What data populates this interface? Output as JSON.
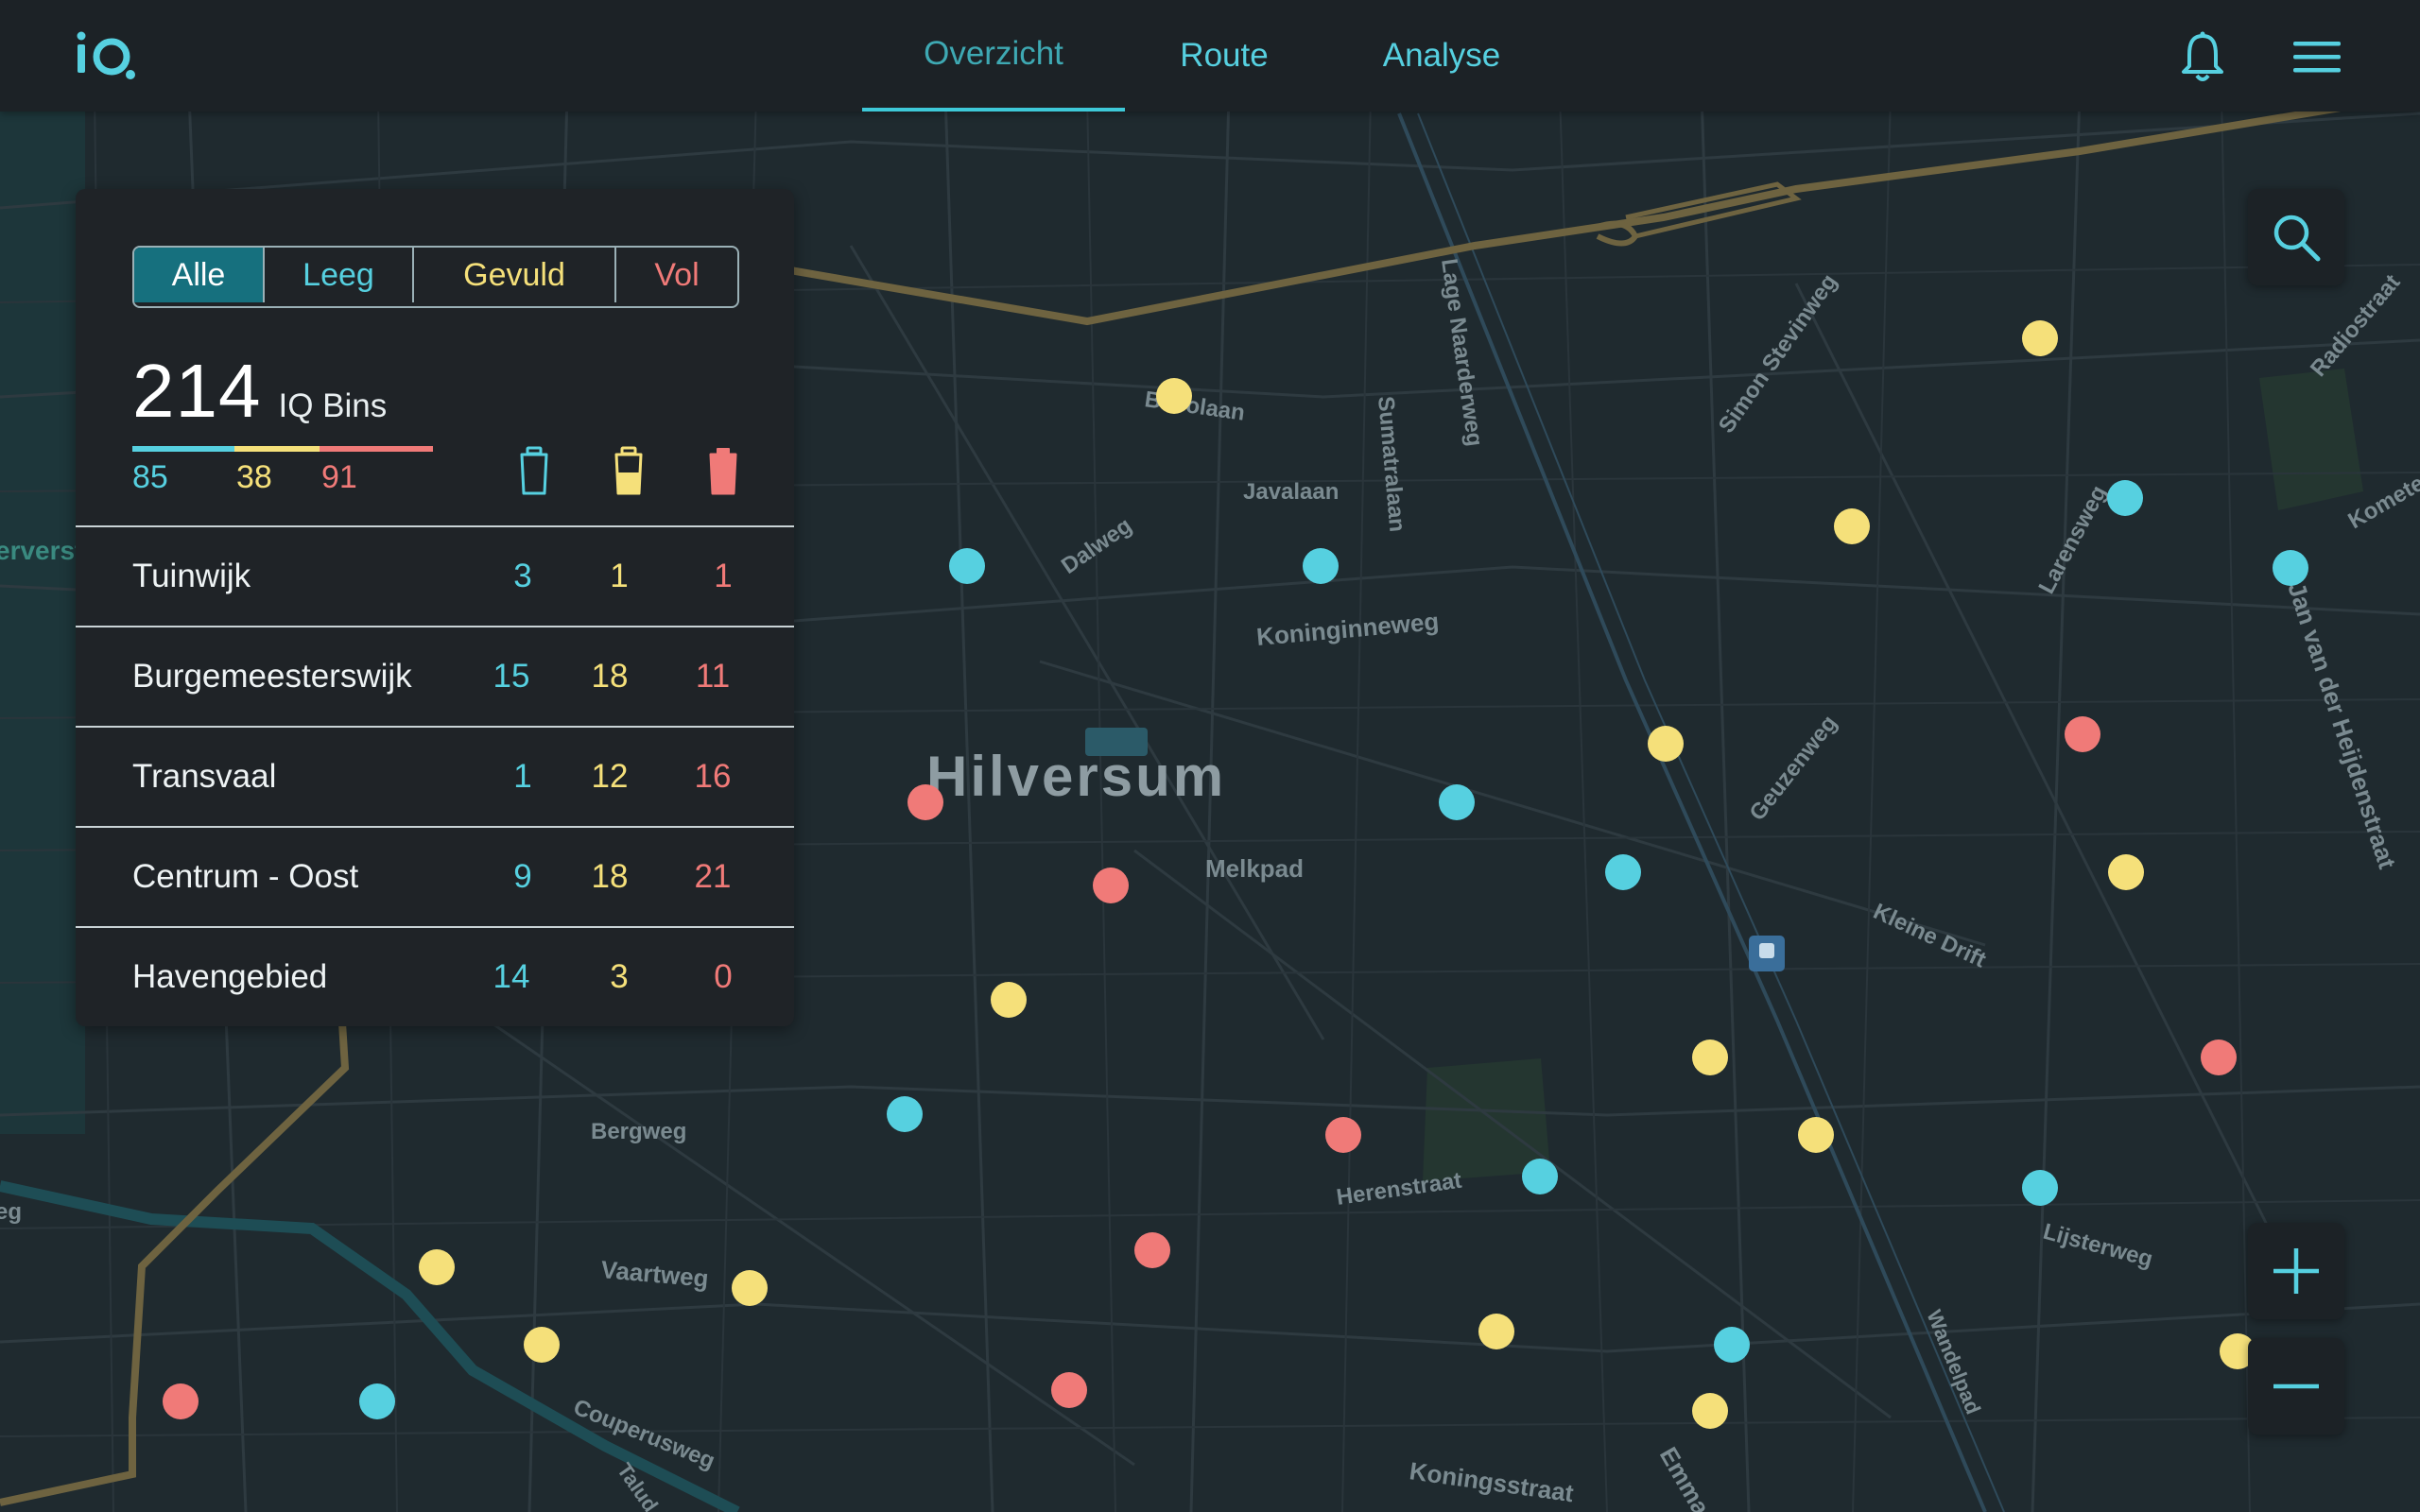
{
  "app": {
    "logo_text": "iQ",
    "accent": "#56d0e0"
  },
  "nav": {
    "tabs": [
      {
        "label": "Overzicht",
        "active": true
      },
      {
        "label": "Route",
        "active": false
      },
      {
        "label": "Analyse",
        "active": false
      }
    ]
  },
  "header_icons": [
    "bell-icon",
    "hamburger-menu-icon"
  ],
  "filters": [
    {
      "label": "Alle",
      "active": true,
      "color": "#ffffff"
    },
    {
      "label": "Leeg",
      "color": "#56d0e0"
    },
    {
      "label": "Gevuld",
      "color": "#f5e07a"
    },
    {
      "label": "Vol",
      "color": "#f07a78"
    }
  ],
  "summary": {
    "total": "214",
    "total_label": "IQ Bins",
    "empty": "85",
    "filled": "38",
    "full": "91"
  },
  "colors": {
    "empty": "#56d0e0",
    "filled": "#f5e07a",
    "full": "#f07a78",
    "panel": "#1f2327",
    "map_bg": "#1f2a2f"
  },
  "districts": [
    {
      "name": "Tuinwijk",
      "empty": "3",
      "filled": "1",
      "full": "1"
    },
    {
      "name": "Burgemeesterswijk",
      "empty": "15",
      "filled": "18",
      "full": "11"
    },
    {
      "name": "Transvaal",
      "empty": "1",
      "filled": "12",
      "full": "16"
    },
    {
      "name": "Centrum - Oost",
      "empty": "9",
      "filled": "18",
      "full": "21"
    },
    {
      "name": "Havengebied",
      "empty": "14",
      "filled": "3",
      "full": "0"
    }
  ],
  "map": {
    "city": "Hilversum",
    "streets": [
      "Beeolaan",
      "Javalaan",
      "Sumatralaan",
      "Lage Naarderweg",
      "Simon Stevinweg",
      "Radiostraat",
      "Dalweg",
      "Koninginneweg",
      "Larensweg",
      "Kometen",
      "Jan van der Heijdenstraat",
      "Geuzenweg",
      "Melkpad",
      "Kleine Drift",
      "Bergweg",
      "Herenstraat",
      "Lijsterweg",
      "Vaartweg",
      "Couperusweg",
      "Talud",
      "Koningsstraat",
      "Emma",
      "Wandelpad",
      "erverst",
      "eg"
    ]
  },
  "map_controls": [
    "search-icon",
    "zoom-in-icon",
    "zoom-out-icon"
  ]
}
